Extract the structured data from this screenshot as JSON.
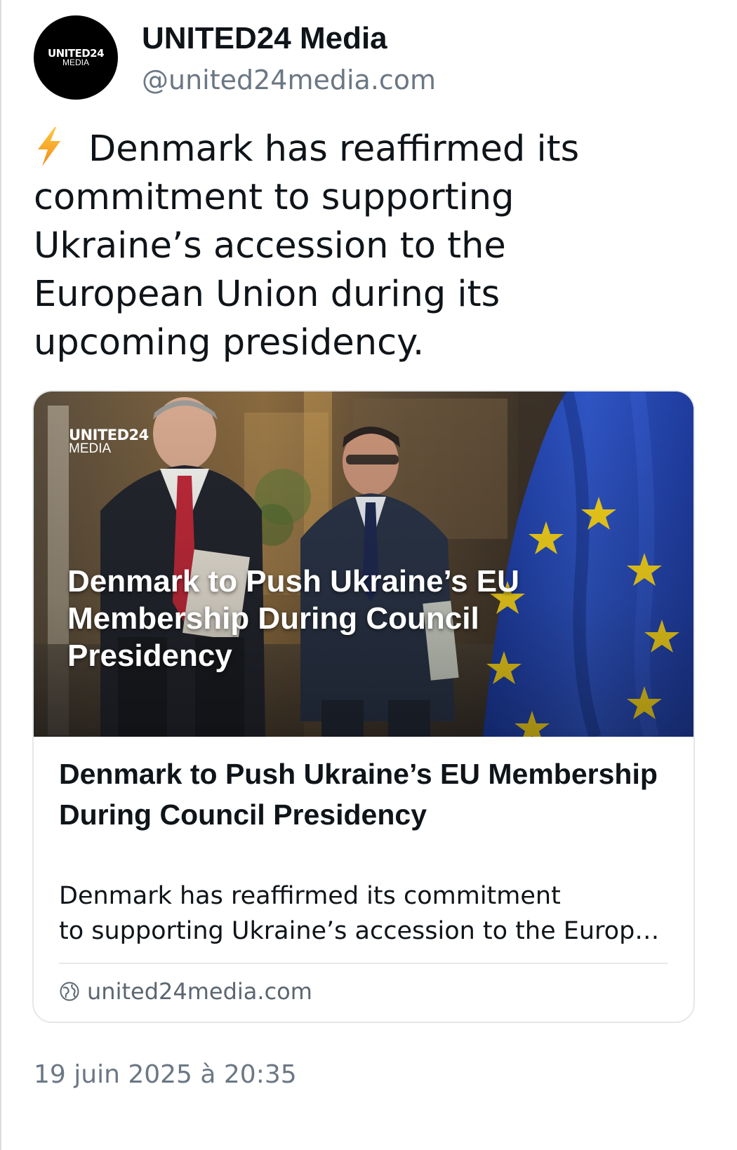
{
  "author": {
    "display_name": "UNITED24 Media",
    "handle": "@united24media.com",
    "avatar_logo": {
      "main": "UNITED24",
      "sub": "MEDIA"
    }
  },
  "post": {
    "emoji_icon": "lightning-bolt-icon",
    "text": "Denmark has reaffirmed its commitment to supporting Ukraine’s accession to the European Union during its upcoming presidency."
  },
  "link_card": {
    "image": {
      "logo_main": "UNITED24",
      "logo_sub": "MEDIA",
      "overlay_title": "Denmark to Push Ukraine’s EU Membership During Council Presidency"
    },
    "title": "Denmark to Push Ukraine’s EU Membership During Council Presidency",
    "description_line1": "Denmark has reaffirmed its commitment",
    "description_line2": "to supporting Ukraine’s accession to the European Union during its upcoming presidency.",
    "domain_icon": "globe-icon",
    "domain": "united24media.com"
  },
  "timestamp": "19 juin 2025 à 20:35",
  "colors": {
    "text_primary": "#0f1419",
    "text_secondary": "#6b7784",
    "card_border": "#e4e7ea",
    "bolt": "#f5a623",
    "eu_blue": "#2443a8",
    "eu_star": "#f4d21c"
  }
}
